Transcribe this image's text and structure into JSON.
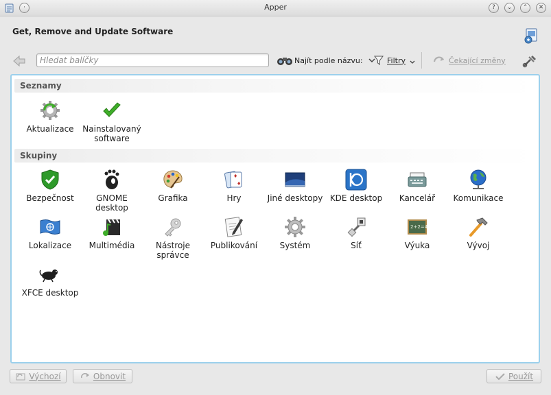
{
  "window": {
    "title": "Apper"
  },
  "header": {
    "heading": "Get, Remove and Update Software"
  },
  "toolbar": {
    "search_placeholder": "Hledat balíčky",
    "find_by_name_label": "Najít podle názvu:",
    "filters_label": "Filtry",
    "pending_changes_label": "Čekající změny"
  },
  "lists": {
    "title": "Seznamy",
    "items": [
      {
        "label": "Aktualizace",
        "icon": "gear-update-icon"
      },
      {
        "label": "Nainstalovaný software",
        "icon": "checkmark-icon"
      }
    ]
  },
  "groups": {
    "title": "Skupiny",
    "items": [
      {
        "label": "Bezpečnost",
        "icon": "shield-icon"
      },
      {
        "label": "GNOME desktop",
        "icon": "gnome-foot-icon"
      },
      {
        "label": "Grafika",
        "icon": "palette-icon"
      },
      {
        "label": "Hry",
        "icon": "cards-icon"
      },
      {
        "label": "Jiné desktopy",
        "icon": "desktop-icon"
      },
      {
        "label": "KDE desktop",
        "icon": "kde-icon"
      },
      {
        "label": "Kancelář",
        "icon": "typewriter-icon"
      },
      {
        "label": "Komunikace",
        "icon": "globe-icon"
      },
      {
        "label": "Lokalizace",
        "icon": "flag-icon"
      },
      {
        "label": "Multimédia",
        "icon": "clapperboard-icon"
      },
      {
        "label": "Nástroje správce",
        "icon": "key-icon"
      },
      {
        "label": "Publikování",
        "icon": "pencil-paper-icon"
      },
      {
        "label": "Systém",
        "icon": "cog-icon"
      },
      {
        "label": "Síť",
        "icon": "network-plug-icon"
      },
      {
        "label": "Výuka",
        "icon": "chalkboard-icon"
      },
      {
        "label": "Vývoj",
        "icon": "hammer-icon"
      },
      {
        "label": "XFCE desktop",
        "icon": "xfce-mouse-icon"
      }
    ]
  },
  "footer": {
    "defaults_label": "Výchozí",
    "reset_label": "Obnovit",
    "apply_label": "Použít"
  },
  "colors": {
    "content_border": "#9cd0ec",
    "disabled_text": "#999999",
    "accent_green": "#3fae29"
  }
}
